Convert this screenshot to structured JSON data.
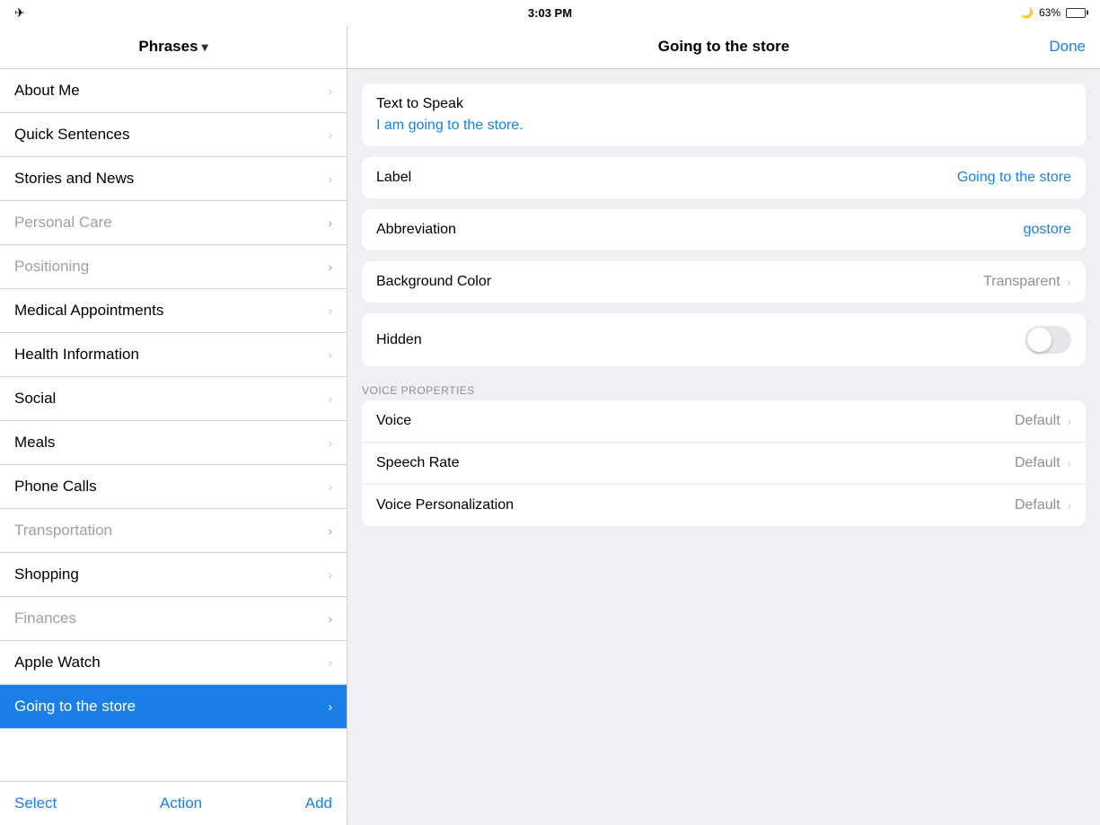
{
  "statusBar": {
    "time": "3:03 PM",
    "batteryPercent": "63%",
    "batteryLevel": 63
  },
  "sidebar": {
    "headerLabel": "Phrases",
    "items": [
      {
        "id": "about-me",
        "label": "About Me",
        "disabled": false
      },
      {
        "id": "quick-sentences",
        "label": "Quick Sentences",
        "disabled": false
      },
      {
        "id": "stories-and-news",
        "label": "Stories and News",
        "disabled": false
      },
      {
        "id": "personal-care",
        "label": "Personal Care",
        "disabled": true
      },
      {
        "id": "positioning",
        "label": "Positioning",
        "disabled": true
      },
      {
        "id": "medical-appointments",
        "label": "Medical Appointments",
        "disabled": false
      },
      {
        "id": "health-information",
        "label": "Health Information",
        "disabled": false
      },
      {
        "id": "social",
        "label": "Social",
        "disabled": false
      },
      {
        "id": "meals",
        "label": "Meals",
        "disabled": false
      },
      {
        "id": "phone-calls",
        "label": "Phone Calls",
        "disabled": false
      },
      {
        "id": "transportation",
        "label": "Transportation",
        "disabled": true
      },
      {
        "id": "shopping",
        "label": "Shopping",
        "disabled": false
      },
      {
        "id": "finances",
        "label": "Finances",
        "disabled": true
      },
      {
        "id": "apple-watch",
        "label": "Apple Watch",
        "disabled": false
      },
      {
        "id": "going-to-the-store",
        "label": "Going to the store",
        "disabled": false,
        "active": true
      }
    ],
    "footer": {
      "selectLabel": "Select",
      "actionLabel": "Action",
      "addLabel": "Add"
    }
  },
  "rightPanel": {
    "title": "Going to the store",
    "doneLabel": "Done",
    "textToSpeak": {
      "sectionLabel": "Text to Speak",
      "value": "I am going to the store."
    },
    "label": {
      "fieldLabel": "Label",
      "value": "Going to the store"
    },
    "abbreviation": {
      "fieldLabel": "Abbreviation",
      "value": "gostore"
    },
    "backgroundColor": {
      "fieldLabel": "Background Color",
      "value": "Transparent"
    },
    "hidden": {
      "fieldLabel": "Hidden",
      "toggled": false
    },
    "voiceProperties": {
      "sectionHeader": "VOICE PROPERTIES",
      "voice": {
        "label": "Voice",
        "value": "Default"
      },
      "speechRate": {
        "label": "Speech Rate",
        "value": "Default"
      },
      "voicePersonalization": {
        "label": "Voice Personalization",
        "value": "Default"
      }
    }
  }
}
